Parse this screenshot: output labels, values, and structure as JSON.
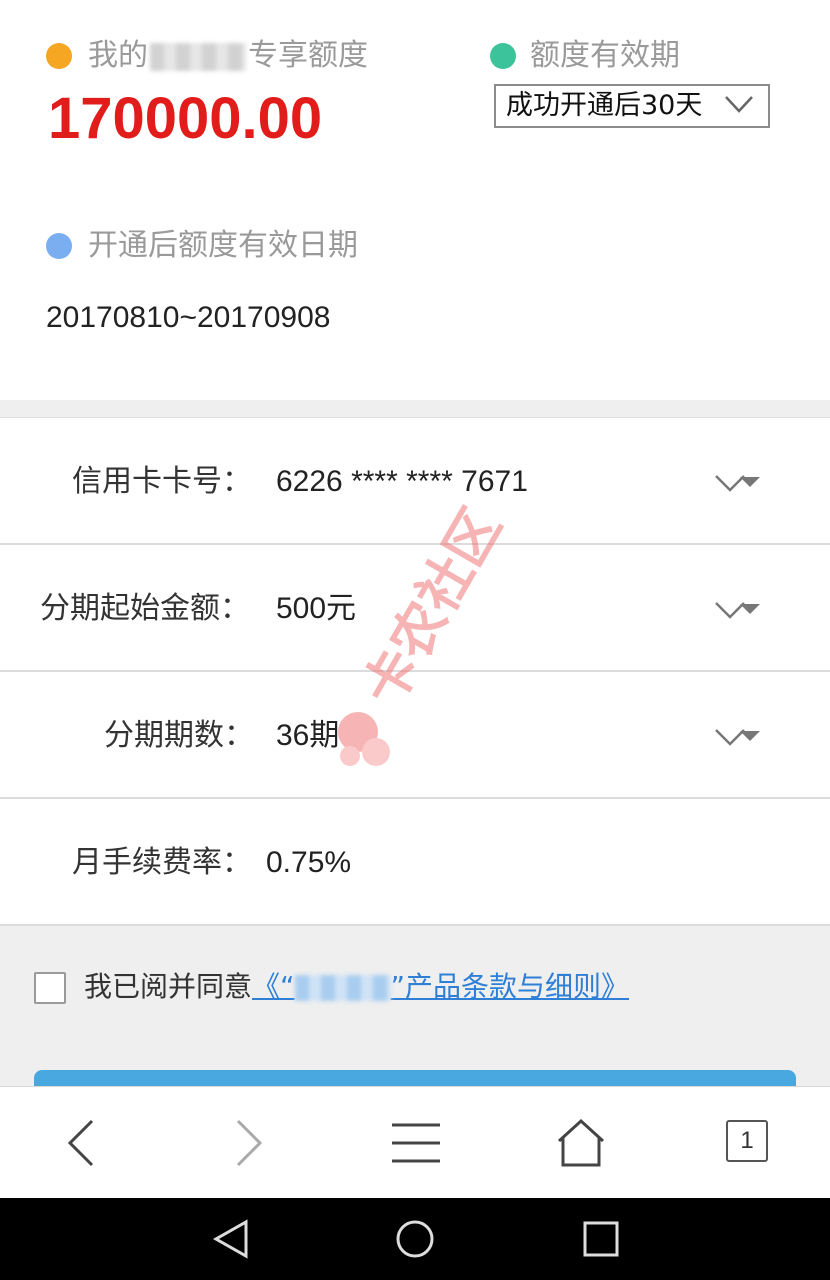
{
  "limit": {
    "label_prefix": "我的",
    "label_suffix": "专享额度",
    "amount": "170000.00",
    "dot_color": "#f5a623"
  },
  "validity": {
    "label": "额度有效期",
    "selected": "成功开通后30天",
    "dot_color": "#3cc39c"
  },
  "effective_date": {
    "label": "开通后额度有效日期",
    "value": "20170810~20170908",
    "dot_color": "#7aaef0"
  },
  "form": {
    "card": {
      "label": "信用卡卡号：",
      "value": "6226 **** **** 7671"
    },
    "min_amount": {
      "label": "分期起始金额：",
      "value": "500元"
    },
    "periods": {
      "label": "分期期数：",
      "value": "36期"
    },
    "fee_rate": {
      "label": "月手续费率：",
      "value": "0.75%"
    }
  },
  "agreement": {
    "prefix": "我已阅并同意",
    "link_open": "《“",
    "link_close": "”产品条款与细则》",
    "checked": false
  },
  "browser_toolbar": {
    "tab_count": "1",
    "icons": [
      "back-icon",
      "forward-icon",
      "menu-icon",
      "home-icon",
      "tabs-icon"
    ]
  },
  "system_nav": {
    "icons": [
      "back-triangle-icon",
      "home-circle-icon",
      "recents-square-icon"
    ]
  },
  "watermark": {
    "text": "卡农社区",
    "color": "#f07878"
  },
  "colors": {
    "amount_red": "#e21b1b",
    "link_blue": "#2f7fd7",
    "button_blue": "#4aa8e0"
  }
}
